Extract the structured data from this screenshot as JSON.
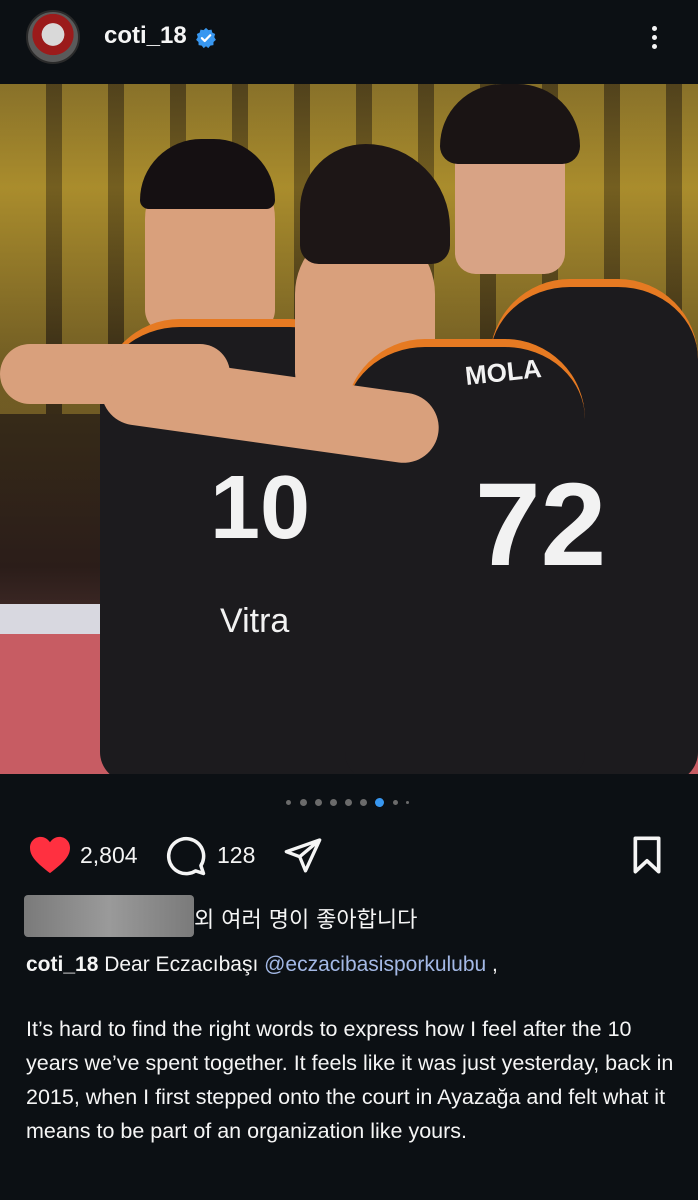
{
  "header": {
    "username": "coti_18",
    "verified": true,
    "more_icon": "more-vertical-icon"
  },
  "post": {
    "jersey_numbers": [
      "10",
      "72"
    ],
    "jersey_text": "Vitra",
    "jersey_name": "MOLA",
    "carousel": {
      "total": 8,
      "active": 6
    }
  },
  "actions": {
    "likes": "2,804",
    "comments": "128",
    "like_color": "#ff3040"
  },
  "liked_by": {
    "text": "외 여러 명이 좋아합니다"
  },
  "caption": {
    "username": "coti_18",
    "text": " Dear Eczacıbaşı ",
    "mention": "@eczacibasisporkulubu",
    "after_mention": " ,",
    "body": "It’s hard to find the right words to express how I feel after the 10 years we’ve spent together. It feels like it was just yesterday, back in 2015, when I first stepped onto the court in Ayazağa and felt what it means to be part of an organization like yours."
  }
}
